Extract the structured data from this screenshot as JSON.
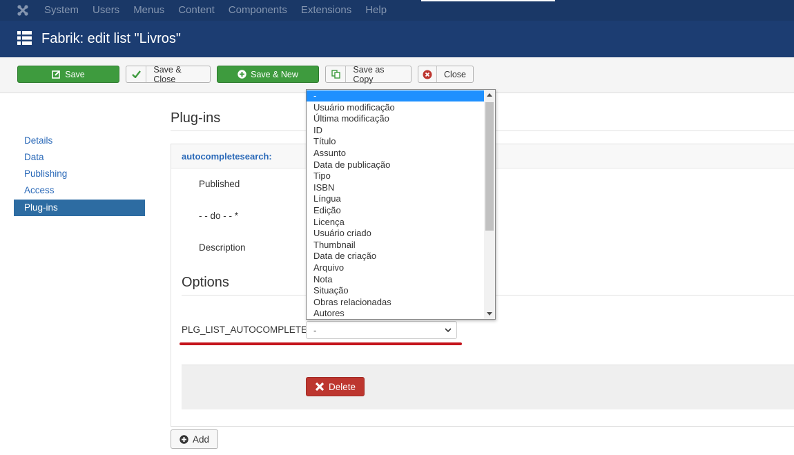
{
  "topbar": {
    "menu": [
      "System",
      "Users",
      "Menus",
      "Content",
      "Components",
      "Extensions",
      "Help"
    ]
  },
  "header": {
    "title": "Fabrik: edit list \"Livros\""
  },
  "toolbar": {
    "save": "Save",
    "save_close": "Save & Close",
    "save_new": "Save & New",
    "save_copy": "Save as Copy",
    "close": "Close"
  },
  "sidebar": {
    "items": [
      {
        "label": "Details"
      },
      {
        "label": "Data"
      },
      {
        "label": "Publishing"
      },
      {
        "label": "Access"
      },
      {
        "label": "Plug-ins",
        "active": true
      }
    ]
  },
  "main": {
    "section_title": "Plug-ins",
    "plugin_name": "autocompletesearch:",
    "labels": {
      "published": "Published",
      "do": "- - do - - *",
      "description": "Description"
    },
    "options_title": "Options",
    "option_label": "PLG_LIST_AUTOCOMPLETES",
    "select_value": "-",
    "delete": "Delete",
    "add": "Add"
  },
  "dropdown": {
    "options": [
      "-",
      "Usuário modificação",
      "Última modificação",
      "ID",
      "Título",
      "Assunto",
      "Data de publicação",
      "Tipo",
      "ISBN",
      "Língua",
      "Edição",
      "Licença",
      "Usuário criado",
      "Thumbnail",
      "Data de criação",
      "Arquivo",
      "Nota",
      "Situação",
      "Obras relacionadas",
      "Autores"
    ],
    "selected_index": 0
  },
  "colors": {
    "topbar": "#1a3867",
    "header": "#1c3d72",
    "green": "#3e9b3e",
    "danger": "#bd362f",
    "active_nav": "#2d6ca2",
    "link": "#2a69b8"
  }
}
